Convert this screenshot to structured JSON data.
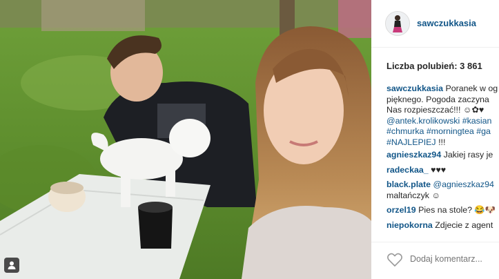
{
  "post": {
    "username": "sawczukkasia",
    "likes_label": "Liczba polubień: 3 861"
  },
  "caption": {
    "username": "sawczukkasia",
    "lines": [
      "Poranek w og",
      "pięknego. Pogoda zaczyna",
      "Nas rozpieszczać!!! ☺✿♥"
    ],
    "links_line1": [
      "@antek.krolikowski",
      "#kasian"
    ],
    "links_line2": [
      "#chmurka",
      "#morningtea",
      "#ga"
    ],
    "links_line3": [
      "#NAJLEPIEJ"
    ],
    "end_text": "!!!"
  },
  "comments": [
    {
      "user": "agnieszkaz94",
      "text": "Jakiej rasy je"
    },
    {
      "user": "radeckaa_",
      "text": "♥♥♥"
    },
    {
      "user": "black.plate",
      "mention": "@agnieszkaz94",
      "text2": "maltańczyk ☺"
    },
    {
      "user": "orzel19",
      "text": "Pies na stole? 😂🐶"
    },
    {
      "user": "niepokorna",
      "text": "Zdjecie z agent"
    }
  ],
  "footer": {
    "add_comment_placeholder": "Dodaj komentarz..."
  },
  "icons": {
    "tag": "person-tag-icon",
    "like": "heart-icon"
  },
  "colors": {
    "link": "#125688",
    "text": "#262626",
    "muted": "#999999"
  }
}
